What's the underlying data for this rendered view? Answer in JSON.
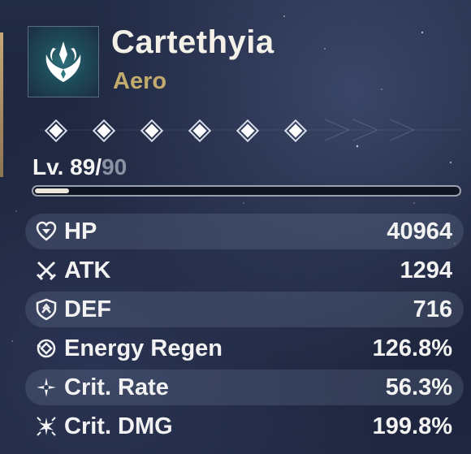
{
  "character": {
    "name": "Cartethyia",
    "element": "Aero",
    "emblem_icon": "aero-emblem-icon",
    "accent_color": "#c3ab6e"
  },
  "resonance": {
    "nodes_total": 6,
    "nodes_active": 6,
    "icon": "diamond-icon"
  },
  "level": {
    "prefix": "Lv. ",
    "current": "89",
    "separator": "/",
    "max": "90",
    "progress_fraction": 0.08
  },
  "stats": [
    {
      "label": "HP",
      "value": "40964",
      "icon": "heart-icon",
      "shaded": true
    },
    {
      "label": "ATK",
      "value": "1294",
      "icon": "crossed-swords-icon",
      "shaded": false
    },
    {
      "label": "DEF",
      "value": "716",
      "icon": "shield-icon",
      "shaded": true
    },
    {
      "label": "Energy Regen",
      "value": "126.8%",
      "icon": "energy-swirl-icon",
      "shaded": false
    },
    {
      "label": "Crit. Rate",
      "value": "56.3%",
      "icon": "spark-icon",
      "shaded": true
    },
    {
      "label": "Crit. DMG",
      "value": "199.8%",
      "icon": "burst-sparks-icon",
      "shaded": false
    }
  ]
}
